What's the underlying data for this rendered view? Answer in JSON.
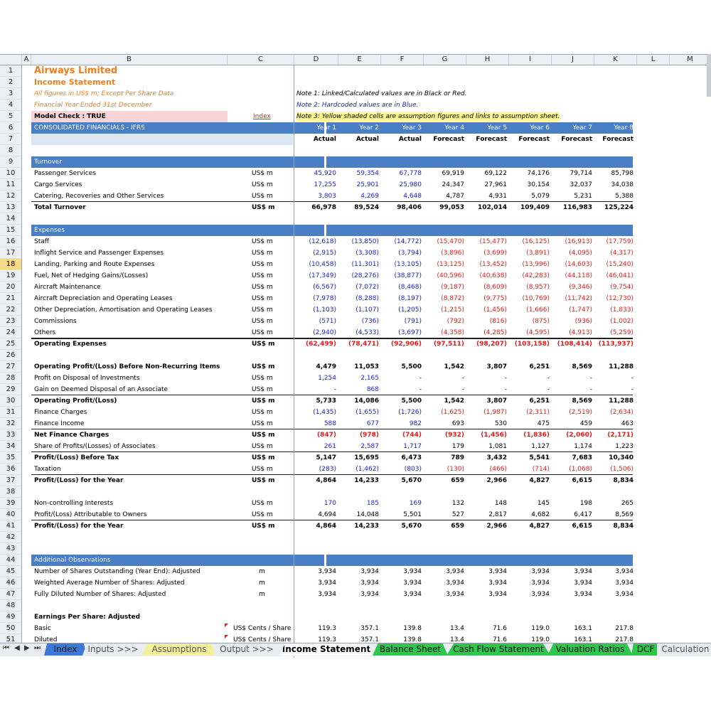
{
  "columns": [
    "A",
    "B",
    "C",
    "D",
    "E",
    "F",
    "G",
    "H",
    "I",
    "J",
    "K",
    "L",
    "M"
  ],
  "selected_row": 18,
  "rows": [
    {
      "n": 1,
      "B": "Airways Limited",
      "Bstyle": "orange-title"
    },
    {
      "n": 2,
      "B": "Income Statement",
      "Bstyle": "orange-sub"
    },
    {
      "n": 3,
      "B": "All figures in US$ m; Except Per Share Data",
      "Bstyle": "orange-ital",
      "note": "Note 1: Linked/Calculated values are in Black or Red."
    },
    {
      "n": 4,
      "B": "Financial Year Ended 31st December",
      "Bstyle": "orange-ital",
      "note": "Note 2: Hardcoded values are in Blue.",
      "notestyle": "blue"
    },
    {
      "n": 5,
      "B": "Model Check : TRUE",
      "Bstyle": "bold-pink",
      "C": "Index",
      "Cstyle": "link",
      "note": "Note 3: Yellow shaded cells are assumption figures and links to assumption sheet.",
      "notestyle": "yellow"
    },
    {
      "n": 6,
      "B": "CONSOLIDATED FINANCIALS - IFRS",
      "Bstyle": "hdr",
      "vals": [
        "Year 1",
        "Year 2",
        "Year 3",
        "Year 4",
        "Year 5",
        "Year 6",
        "Year 7",
        "Year 8"
      ],
      "valstyle": "hdr"
    },
    {
      "n": 7,
      "Bstyle": "light",
      "vals": [
        "Actual",
        "Actual",
        "Actual",
        "Forecast",
        "Forecast",
        "Forecast",
        "Forecast",
        "Forecast"
      ],
      "valstyle": "bold"
    },
    {
      "n": 8
    },
    {
      "n": 9,
      "B": "Turnover",
      "Bstyle": "hdr"
    },
    {
      "n": 10,
      "B": "Passenger Services",
      "C": "US$ m",
      "vals": [
        "45,920",
        "59,354",
        "67,778",
        "69,919",
        "69,122",
        "74,176",
        "79,714",
        "85,798"
      ],
      "colors": [
        "blue",
        "blue",
        "blue",
        "",
        "",
        "",
        "",
        ""
      ]
    },
    {
      "n": 11,
      "B": "Cargo Services",
      "C": "US$ m",
      "vals": [
        "17,255",
        "25,901",
        "25,980",
        "24,347",
        "27,961",
        "30,154",
        "32,037",
        "34,038"
      ],
      "colors": [
        "blue",
        "blue",
        "blue",
        "",
        "",
        "",
        "",
        ""
      ]
    },
    {
      "n": 12,
      "B": "Catering, Recoveries and Other Services",
      "C": "US$ m",
      "vals": [
        "3,803",
        "4,269",
        "4,648",
        "4,787",
        "4,931",
        "5,079",
        "5,231",
        "5,388"
      ],
      "colors": [
        "blue",
        "blue",
        "blue",
        "",
        "",
        "",
        "",
        ""
      ],
      "line": "bottom"
    },
    {
      "n": 13,
      "B": "Total Turnover",
      "C": "US$ m",
      "bold": true,
      "vals": [
        "66,978",
        "89,524",
        "98,406",
        "99,053",
        "102,014",
        "109,409",
        "116,983",
        "125,224"
      ]
    },
    {
      "n": 14
    },
    {
      "n": 15,
      "B": "Expenses",
      "Bstyle": "hdr"
    },
    {
      "n": 16,
      "B": "Staff",
      "C": "US$ m",
      "vals": [
        "(12,618)",
        "(13,850)",
        "(14,772)",
        "(15,470)",
        "(15,477)",
        "(16,125)",
        "(16,913)",
        "(17,759)"
      ],
      "colors": [
        "blue",
        "blue",
        "blue",
        "red",
        "red",
        "red",
        "red",
        "red"
      ]
    },
    {
      "n": 17,
      "B": "Inflight Service and Passenger Expenses",
      "C": "US$ m",
      "vals": [
        "(2,915)",
        "(3,308)",
        "(3,794)",
        "(3,896)",
        "(3,699)",
        "(3,891)",
        "(4,095)",
        "(4,317)"
      ],
      "colors": [
        "blue",
        "blue",
        "blue",
        "red",
        "red",
        "red",
        "red",
        "red"
      ]
    },
    {
      "n": 18,
      "B": "Landing, Parking and Route Expenses",
      "C": "US$ m",
      "vals": [
        "(10,458)",
        "(11,301)",
        "(13,105)",
        "(13,125)",
        "(13,452)",
        "(13,996)",
        "(14,603)",
        "(15,240)"
      ],
      "colors": [
        "blue",
        "blue",
        "blue",
        "red",
        "red",
        "red",
        "red",
        "red"
      ]
    },
    {
      "n": 19,
      "B": "Fuel, Net of Hedging Gains/(Losses)",
      "C": "US$ m",
      "vals": [
        "(17,349)",
        "(28,276)",
        "(38,877)",
        "(40,596)",
        "(40,638)",
        "(42,283)",
        "(44,118)",
        "(46,041)"
      ],
      "colors": [
        "blue",
        "blue",
        "blue",
        "red",
        "red",
        "red",
        "red",
        "red"
      ]
    },
    {
      "n": 20,
      "B": "Aircraft Maintenance",
      "C": "US$ m",
      "vals": [
        "(6,567)",
        "(7,072)",
        "(8,468)",
        "(9,187)",
        "(8,609)",
        "(8,957)",
        "(9,346)",
        "(9,754)"
      ],
      "colors": [
        "blue",
        "blue",
        "blue",
        "red",
        "red",
        "red",
        "red",
        "red"
      ]
    },
    {
      "n": 21,
      "B": "Aircraft Depreciation and Operating Leases",
      "C": "US$ m",
      "vals": [
        "(7,978)",
        "(8,288)",
        "(8,197)",
        "(8,872)",
        "(9,775)",
        "(10,769)",
        "(11,742)",
        "(12,730)"
      ],
      "colors": [
        "blue",
        "blue",
        "blue",
        "red",
        "red",
        "red",
        "red",
        "red"
      ]
    },
    {
      "n": 22,
      "B": "Other Depreciation, Amortisation and Operating Leases",
      "C": "US$ m",
      "vals": [
        "(1,103)",
        "(1,107)",
        "(1,205)",
        "(1,215)",
        "(1,456)",
        "(1,666)",
        "(1,747)",
        "(1,833)"
      ],
      "colors": [
        "blue",
        "blue",
        "blue",
        "red",
        "red",
        "red",
        "red",
        "red"
      ]
    },
    {
      "n": 23,
      "B": "Commissions",
      "C": "US$ m",
      "vals": [
        "(571)",
        "(736)",
        "(791)",
        "(792)",
        "(816)",
        "(875)",
        "(936)",
        "(1,002)"
      ],
      "colors": [
        "blue",
        "blue",
        "blue",
        "red",
        "red",
        "red",
        "red",
        "red"
      ]
    },
    {
      "n": 24,
      "B": "Others",
      "C": "US$ m",
      "vals": [
        "(2,940)",
        "(4,533)",
        "(3,697)",
        "(4,358)",
        "(4,285)",
        "(4,595)",
        "(4,913)",
        "(5,259)"
      ],
      "colors": [
        "blue",
        "blue",
        "blue",
        "red",
        "red",
        "red",
        "red",
        "red"
      ],
      "line": "bottom"
    },
    {
      "n": 25,
      "B": "Operating Expenses",
      "C": "US$ m",
      "bold": true,
      "vals": [
        "(62,499)",
        "(78,471)",
        "(92,906)",
        "(97,511)",
        "(98,207)",
        "(103,158)",
        "(108,414)",
        "(113,937)"
      ],
      "colors": [
        "red",
        "red",
        "red",
        "red",
        "red",
        "red",
        "red",
        "red"
      ],
      "line": "thick"
    },
    {
      "n": 26
    },
    {
      "n": 27,
      "B": "Operating Profit/(Loss) Before Non-Recurring Items",
      "C": "US$ m",
      "bold": true,
      "vals": [
        "4,479",
        "11,053",
        "5,500",
        "1,542",
        "3,807",
        "6,251",
        "8,569",
        "11,288"
      ]
    },
    {
      "n": 28,
      "B": "Profit on Disposal of Investments",
      "C": "US$ m",
      "vals": [
        "1,254",
        "2,165",
        "-",
        "-",
        "-",
        "-",
        "-",
        "-"
      ],
      "colors": [
        "blue",
        "blue",
        "",
        "",
        "",
        "",
        "",
        ""
      ]
    },
    {
      "n": 29,
      "B": "Gain on Deemed Disposal of an Associate",
      "C": "US$ m",
      "vals": [
        "-",
        "868",
        "-",
        "-",
        "-",
        "-",
        "-",
        "-"
      ],
      "colors": [
        "",
        "blue",
        "",
        "",
        "",
        "",
        "",
        ""
      ],
      "line": "bottom"
    },
    {
      "n": 30,
      "B": "Operating Profit/(Loss)",
      "C": "US$ m",
      "bold": true,
      "vals": [
        "5,733",
        "14,086",
        "5,500",
        "1,542",
        "3,807",
        "6,251",
        "8,569",
        "11,288"
      ]
    },
    {
      "n": 31,
      "B": "Finance Charges",
      "C": "US$ m",
      "vals": [
        "(1,435)",
        "(1,655)",
        "(1,726)",
        "(1,625)",
        "(1,987)",
        "(2,311)",
        "(2,519)",
        "(2,634)"
      ],
      "colors": [
        "blue",
        "blue",
        "blue",
        "red",
        "red",
        "red",
        "red",
        "red"
      ]
    },
    {
      "n": 32,
      "B": "Finance Income",
      "C": "US$ m",
      "vals": [
        "588",
        "677",
        "982",
        "693",
        "530",
        "475",
        "459",
        "463"
      ],
      "colors": [
        "blue",
        "blue",
        "blue",
        "",
        "",
        "",
        "",
        ""
      ],
      "line": "bottom"
    },
    {
      "n": 33,
      "B": "Net Finance Charges",
      "C": "US$ m",
      "bold": true,
      "vals": [
        "(847)",
        "(978)",
        "(744)",
        "(932)",
        "(1,456)",
        "(1,836)",
        "(2,060)",
        "(2,171)"
      ],
      "colors": [
        "red",
        "red",
        "red",
        "red",
        "red",
        "red",
        "red",
        "red"
      ]
    },
    {
      "n": 34,
      "B": "Share of Profits/(Losses) of Associates",
      "C": "US$ m",
      "vals": [
        "261",
        "2,587",
        "1,717",
        "179",
        "1,081",
        "1,127",
        "1,174",
        "1,223"
      ],
      "colors": [
        "blue",
        "blue",
        "blue",
        "",
        "",
        "",
        "",
        ""
      ],
      "line": "bottom"
    },
    {
      "n": 35,
      "B": "Profit/(Loss) Before Tax",
      "C": "US$ m",
      "bold": true,
      "vals": [
        "5,147",
        "15,695",
        "6,473",
        "789",
        "3,432",
        "5,541",
        "7,683",
        "10,340"
      ]
    },
    {
      "n": 36,
      "B": "Taxation",
      "C": "US$ m",
      "vals": [
        "(283)",
        "(1,462)",
        "(803)",
        "(130)",
        "(466)",
        "(714)",
        "(1,068)",
        "(1,506)"
      ],
      "colors": [
        "blue",
        "blue",
        "blue",
        "red",
        "red",
        "red",
        "red",
        "red"
      ],
      "line": "bottom"
    },
    {
      "n": 37,
      "B": "Profit/(Loss) for the Year",
      "C": "US$ m",
      "bold": true,
      "vals": [
        "4,864",
        "14,233",
        "5,670",
        "659",
        "2,966",
        "4,827",
        "6,615",
        "8,834"
      ]
    },
    {
      "n": 38
    },
    {
      "n": 39,
      "B": "Non-controlling Interests",
      "C": "US$ m",
      "vals": [
        "170",
        "185",
        "169",
        "132",
        "148",
        "145",
        "198",
        "265"
      ],
      "colors": [
        "blue",
        "blue",
        "blue",
        "",
        "",
        "",
        "",
        ""
      ]
    },
    {
      "n": 40,
      "B": "Profit/(Loss) Attributable to Owners",
      "C": "US$ m",
      "vals": [
        "4,694",
        "14,048",
        "5,501",
        "527",
        "2,817",
        "4,682",
        "6,417",
        "8,569"
      ],
      "line": "bottom"
    },
    {
      "n": 41,
      "B": "Profit/(Loss) for the Year",
      "C": "US$ m",
      "bold": true,
      "vals": [
        "4,864",
        "14,233",
        "5,670",
        "659",
        "2,966",
        "4,827",
        "6,615",
        "8,834"
      ]
    },
    {
      "n": 42
    },
    {
      "n": 43
    },
    {
      "n": 44,
      "B": "Additional Observations",
      "Bstyle": "hdr"
    },
    {
      "n": 45,
      "B": "Number of Shares Outstanding (Year End): Adjusted",
      "C": "m",
      "Cc": true,
      "vals": [
        "3,934",
        "3,934",
        "3,934",
        "3,934",
        "3,934",
        "3,934",
        "3,934",
        "3,934"
      ]
    },
    {
      "n": 46,
      "B": "Weighted Average Number of Shares: Adjusted",
      "C": "m",
      "Cc": true,
      "vals": [
        "3,934",
        "3,934",
        "3,934",
        "3,934",
        "3,934",
        "3,934",
        "3,934",
        "3,934"
      ]
    },
    {
      "n": 47,
      "B": "Fully Diluted Number of Shares: Adjusted",
      "C": "m",
      "Cc": true,
      "vals": [
        "3,934",
        "3,934",
        "3,934",
        "3,934",
        "3,934",
        "3,934",
        "3,934",
        "3,934"
      ]
    },
    {
      "n": 48
    },
    {
      "n": 49,
      "B": "Earnings Per Share: Adjusted",
      "Bbold": true
    },
    {
      "n": 50,
      "B": "Basic",
      "C": "US$ Cents / Share",
      "Cflag": true,
      "vals": [
        "119.3",
        "357.1",
        "139.8",
        "13.4",
        "71.6",
        "119.0",
        "163.1",
        "217.8"
      ]
    },
    {
      "n": 51,
      "B": "Diluted",
      "C": "US$ Cents / Share",
      "Cflag": true,
      "vals": [
        "119.3",
        "357.1",
        "139.8",
        "13.4",
        "71.6",
        "119.0",
        "163.1",
        "217.8"
      ]
    }
  ],
  "tabs": [
    {
      "label": "Index",
      "style": "blue"
    },
    {
      "label": "Inputs >>>",
      "style": "plain"
    },
    {
      "label": "Assumptions",
      "style": "yellow"
    },
    {
      "label": "Output >>>",
      "style": "plain"
    },
    {
      "label": "Income Statement",
      "style": "active"
    },
    {
      "label": "Balance Sheet",
      "style": "green"
    },
    {
      "label": "Cash Flow Statement",
      "style": "green"
    },
    {
      "label": "Valuation Ratios",
      "style": "green"
    },
    {
      "label": "DCF",
      "style": "green"
    },
    {
      "label": "Calculation",
      "style": "plain"
    }
  ],
  "colors": {
    "header_blue": "#4b7fc3",
    "orange": "#ee7d1e",
    "hardcoded_blue": "#1f22c8",
    "negative_red": "#e11b1b",
    "tab_green": "#2bc84a",
    "tab_yellow": "#f4f19a",
    "selected_row": "#f9d88a"
  }
}
